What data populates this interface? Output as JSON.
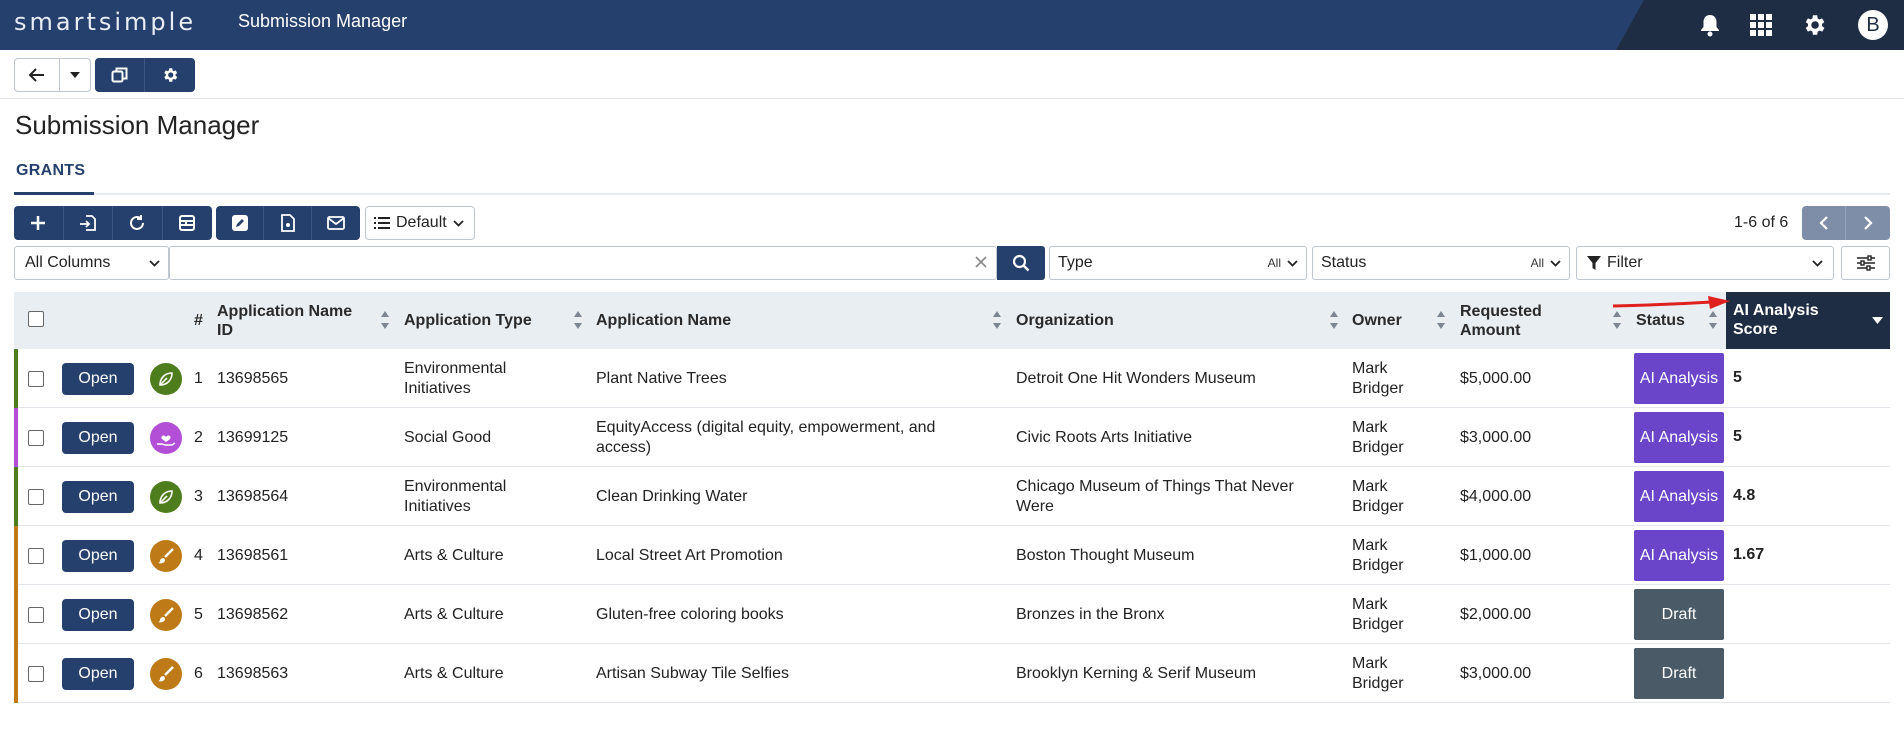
{
  "header": {
    "logo_text": "smartsimple",
    "app_title": "Submission Manager",
    "avatar_letter": "B",
    "icons": [
      "bell-icon",
      "grid-icon",
      "gear-icon"
    ]
  },
  "page": {
    "title": "Submission Manager",
    "tab_label": "GRANTS"
  },
  "toolbar": {
    "view_label": "Default",
    "pager_text": "1-6 of 6"
  },
  "search": {
    "columns_select": "All Columns",
    "search_placeholder": "",
    "type_label": "Type",
    "type_value": "All",
    "status_label": "Status",
    "status_value": "All",
    "filter_label": "Filter"
  },
  "table": {
    "headers": {
      "num": "#",
      "app_id": "Application Name ID",
      "app_type": "Application Type",
      "app_name": "Application Name",
      "organization": "Organization",
      "owner": "Owner",
      "amount": "Requested Amount",
      "status": "Status",
      "ai_score": "AI Analysis Score"
    },
    "open_label": "Open",
    "rows": [
      {
        "num": "1",
        "id": "13698565",
        "type": "Environmental Initiatives",
        "name": "Plant Native Trees",
        "org": "Detroit One Hit Wonders Museum",
        "owner": "Mark Bridger",
        "amount": "$5,000.00",
        "status": "AI Analysis",
        "score": "5",
        "color": "#4e7d1d",
        "icon": "leaf-icon"
      },
      {
        "num": "2",
        "id": "13699125",
        "type": "Social Good",
        "name": "EquityAccess (digital equity, empowerment, and access)",
        "org": "Civic Roots Arts Initiative",
        "owner": "Mark Bridger",
        "amount": "$3,000.00",
        "status": "AI Analysis",
        "score": "5",
        "color": "#b34fd6",
        "icon": "heart-hand-icon"
      },
      {
        "num": "3",
        "id": "13698564",
        "type": "Environmental Initiatives",
        "name": "Clean Drinking Water",
        "org": "Chicago Museum of Things That Never Were",
        "owner": "Mark Bridger",
        "amount": "$4,000.00",
        "status": "AI Analysis",
        "score": "4.8",
        "color": "#4e7d1d",
        "icon": "leaf-icon"
      },
      {
        "num": "4",
        "id": "13698561",
        "type": "Arts & Culture",
        "name": "Local Street Art Promotion",
        "org": "Boston Thought Museum",
        "owner": "Mark Bridger",
        "amount": "$1,000.00",
        "status": "AI Analysis",
        "score": "1.67",
        "color": "#bf7a18",
        "icon": "paintbrush-icon"
      },
      {
        "num": "5",
        "id": "13698562",
        "type": "Arts & Culture",
        "name": "Gluten-free coloring books",
        "org": "Bronzes in the Bronx",
        "owner": "Mark Bridger",
        "amount": "$2,000.00",
        "status": "Draft",
        "score": "",
        "color": "#bf7a18",
        "icon": "paintbrush-icon"
      },
      {
        "num": "6",
        "id": "13698563",
        "type": "Arts & Culture",
        "name": "Artisan Subway Tile Selfies",
        "org": "Brooklyn Kerning & Serif Museum",
        "owner": "Mark Bridger",
        "amount": "$3,000.00",
        "status": "Draft",
        "score": "",
        "color": "#bf7a18",
        "icon": "paintbrush-icon"
      }
    ]
  },
  "colors": {
    "header_bg": "#26406d",
    "ai_status": "#6a45c9",
    "draft_status": "#4a5a66",
    "annotation_arrow": "#e0201d"
  }
}
